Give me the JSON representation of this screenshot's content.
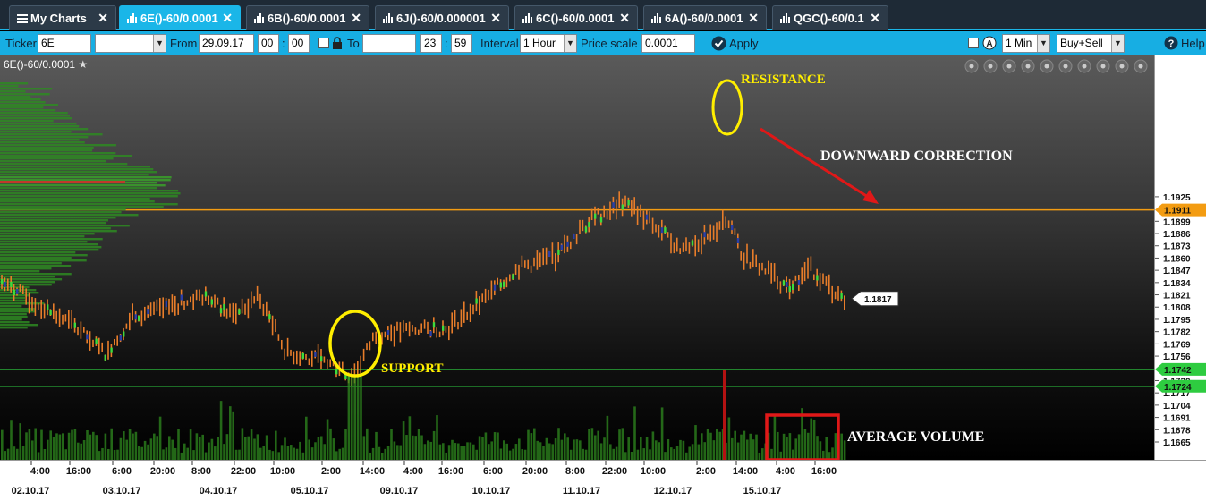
{
  "tabs": [
    {
      "label": "My Charts",
      "icon": "menu-icon",
      "active": false
    },
    {
      "label": "6E()-60/0.0001",
      "icon": "bar-chart-icon",
      "active": true
    },
    {
      "label": "6B()-60/0.0001",
      "icon": "bar-chart-icon",
      "active": false
    },
    {
      "label": "6J()-60/0.000001",
      "icon": "bar-chart-icon",
      "active": false
    },
    {
      "label": "6C()-60/0.0001",
      "icon": "bar-chart-icon",
      "active": false
    },
    {
      "label": "6A()-60/0.0001",
      "icon": "bar-chart-icon",
      "active": false
    },
    {
      "label": "QGC()-60/0.1",
      "icon": "bar-chart-icon",
      "active": false
    }
  ],
  "toolbar": {
    "ticker_label": "Ticker",
    "ticker_value": "6E",
    "from_label": "From",
    "from_date": "29.09.17",
    "from_hour": "00",
    "from_minute": "00",
    "to_label": "To",
    "to_date": "",
    "to_hour": "23",
    "to_minute": "59",
    "interval_label": "Interval",
    "interval_value": "1 Hour",
    "price_scale_label": "Price scale",
    "price_scale_value": "0.0001",
    "apply_label": "Apply",
    "timeframe_value": "1 Min",
    "side_value": "Buy+Sell",
    "help_label": "Help"
  },
  "chart": {
    "title": "6E()-60/0.0001",
    "price_ticks": [
      "1.1925",
      "1.1899",
      "1.1886",
      "1.1873",
      "1.1860",
      "1.1847",
      "1.1834",
      "1.1821",
      "1.1808",
      "1.1795",
      "1.1782",
      "1.1769",
      "1.1756",
      "1.1730",
      "1.1717",
      "1.1704",
      "1.1691",
      "1.1678",
      "1.1665"
    ],
    "time_ticks": [
      "4:00",
      "16:00",
      "6:00",
      "20:00",
      "8:00",
      "22:00",
      "10:00",
      "2:00",
      "14:00",
      "4:00",
      "16:00",
      "6:00",
      "20:00",
      "8:00",
      "22:00",
      "10:00",
      "2:00",
      "14:00",
      "4:00",
      "16:00"
    ],
    "date_ticks": [
      "02.10.17",
      "03.10.17",
      "04.10.17",
      "05.10.17",
      "09.10.17",
      "10.10.17",
      "11.10.17",
      "12.10.17",
      "15.10.17"
    ],
    "level_lines": [
      {
        "price": "1.1911",
        "color": "#f39c12"
      },
      {
        "price": "1.1742",
        "color": "#2ecc40"
      },
      {
        "price": "1.1724",
        "color": "#2ecc40"
      }
    ],
    "last_price": "1.1817",
    "annotations": {
      "resistance": "RESISTANCE",
      "support": "SUPPORT",
      "downward": "DOWNWARD CORRECTION",
      "volume": "AVERAGE VOLUME"
    },
    "colors": {
      "candles": "#e87d2a",
      "up_mark": "#3ddc3d",
      "down_mark": "#2b3fa8",
      "volume": "#2f8a1f",
      "highlight": "#ffee00",
      "arrow": "#e01818"
    },
    "tool_icons": [
      "zoom-fit-icon",
      "zoom-in-icon",
      "zoom-out-icon",
      "grid-icon",
      "refresh-icon",
      "refresh-alt-icon",
      "settings-icon",
      "popout-icon",
      "close-icon",
      "collapse-icon"
    ]
  }
}
